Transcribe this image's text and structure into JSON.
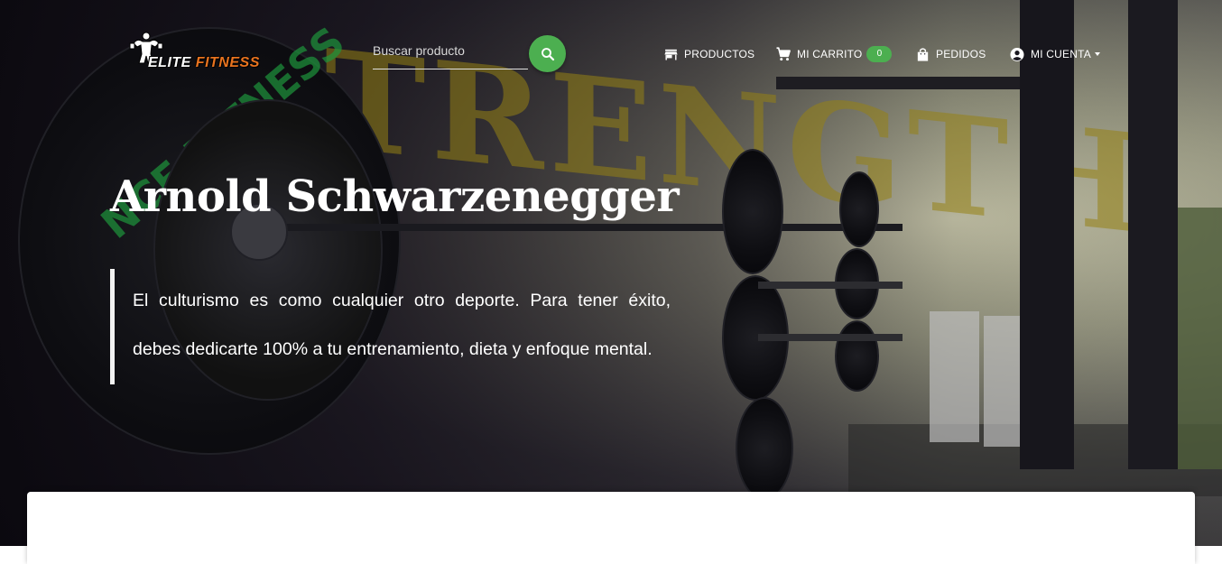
{
  "brand": {
    "word1": "ELITE",
    "word2": "FITNESS"
  },
  "search": {
    "placeholder": "Buscar producto",
    "value": "",
    "icon": "search-icon"
  },
  "nav": {
    "productos": {
      "label": "PRODUCTOS",
      "icon": "store-icon"
    },
    "carrito": {
      "label": "MI CARRITO",
      "icon": "cart-icon",
      "count": "0"
    },
    "pedidos": {
      "label": "PEDIDOS",
      "icon": "shopping-bag-icon"
    },
    "cuenta": {
      "label": "MI CUENTA",
      "icon": "account-circle-icon"
    }
  },
  "hero": {
    "title": "Arnold Schwarzenegger",
    "quote_line1": "El culturismo es como cualquier otro deporte. Para tener éxito,",
    "quote_line2": "debes dedicarte 100% a tu entrenamiento, dieta y enfoque mental."
  },
  "colors": {
    "accent": "#4caf50",
    "brand_orange": "#e8731f",
    "text": "#ffffff",
    "card": "#ffffff"
  }
}
